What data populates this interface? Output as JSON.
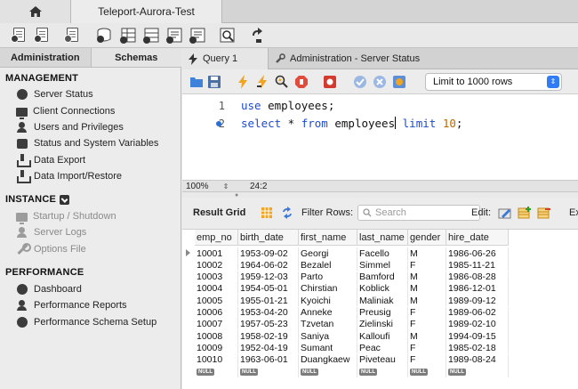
{
  "window": {
    "home_icon": "home-icon",
    "connection_tab": "Teleport-Aurora-Test"
  },
  "toolbar": {
    "icons": [
      "new-sql-tab-icon",
      "open-sql-file-icon",
      "inspector-icon",
      "create-schema-icon",
      "create-table-icon",
      "create-view-icon",
      "create-procedure-icon",
      "create-function-icon",
      "search-table-data-icon",
      "reconnect-icon"
    ]
  },
  "sidebar": {
    "tabs": [
      {
        "label": "Administration",
        "active": true
      },
      {
        "label": "Schemas",
        "active": false
      }
    ],
    "sections": [
      {
        "title": "MANAGEMENT",
        "items": [
          {
            "label": "Server Status",
            "icon": "server-status-icon",
            "enabled": true
          },
          {
            "label": "Client Connections",
            "icon": "client-connections-icon",
            "enabled": true
          },
          {
            "label": "Users and Privileges",
            "icon": "users-icon",
            "enabled": true
          },
          {
            "label": "Status and System Variables",
            "icon": "variables-icon",
            "enabled": true
          },
          {
            "label": "Data Export",
            "icon": "data-export-icon",
            "enabled": true
          },
          {
            "label": "Data Import/Restore",
            "icon": "data-import-icon",
            "enabled": true
          }
        ]
      },
      {
        "title": "INSTANCE",
        "items": [
          {
            "label": "Startup / Shutdown",
            "icon": "startup-icon",
            "enabled": false
          },
          {
            "label": "Server Logs",
            "icon": "server-logs-icon",
            "enabled": false
          },
          {
            "label": "Options File",
            "icon": "wrench-icon",
            "enabled": false
          }
        ]
      },
      {
        "title": "PERFORMANCE",
        "items": [
          {
            "label": "Dashboard",
            "icon": "dashboard-icon",
            "enabled": true
          },
          {
            "label": "Performance Reports",
            "icon": "performance-reports-icon",
            "enabled": true
          },
          {
            "label": "Performance Schema Setup",
            "icon": "performance-setup-icon",
            "enabled": true
          }
        ]
      }
    ]
  },
  "query_tabs": [
    {
      "label": "Query 1",
      "icon": "lightning-icon",
      "active": true
    },
    {
      "label": "Administration - Server Status",
      "icon": "wrench-icon",
      "active": false
    }
  ],
  "editor_toolbar": {
    "limit_label": "Limit to 1000 rows"
  },
  "editor": {
    "lines": [
      {
        "num": "1",
        "tokens": [
          {
            "t": "use",
            "k": "kw"
          },
          {
            "t": " employees;",
            "k": ""
          }
        ]
      },
      {
        "num": "2",
        "tokens": [
          {
            "t": "select",
            "k": "kw"
          },
          {
            "t": " * ",
            "k": ""
          },
          {
            "t": "from",
            "k": "kw"
          },
          {
            "t": " employees",
            "k": ""
          },
          {
            "t": "|",
            "k": "caret"
          },
          {
            "t": " ",
            "k": ""
          },
          {
            "t": "limit",
            "k": "kw"
          },
          {
            "t": " ",
            "k": ""
          },
          {
            "t": "10",
            "k": "num"
          },
          {
            "t": ";",
            "k": ""
          }
        ]
      }
    ],
    "zoom": "100%",
    "cursor_pos": "24:2"
  },
  "result_toolbar": {
    "title": "Result Grid",
    "filter_label": "Filter Rows:",
    "filter_placeholder": "Search",
    "edit_label": "Edit:",
    "export_label": "Ex"
  },
  "grid": {
    "columns": [
      "emp_no",
      "birth_date",
      "first_name",
      "last_name",
      "gender",
      "hire_date"
    ],
    "rows": [
      [
        "10001",
        "1953-09-02",
        "Georgi",
        "Facello",
        "M",
        "1986-06-26"
      ],
      [
        "10002",
        "1964-06-02",
        "Bezalel",
        "Simmel",
        "F",
        "1985-11-21"
      ],
      [
        "10003",
        "1959-12-03",
        "Parto",
        "Bamford",
        "M",
        "1986-08-28"
      ],
      [
        "10004",
        "1954-05-01",
        "Chirstian",
        "Koblick",
        "M",
        "1986-12-01"
      ],
      [
        "10005",
        "1955-01-21",
        "Kyoichi",
        "Maliniak",
        "M",
        "1989-09-12"
      ],
      [
        "10006",
        "1953-04-20",
        "Anneke",
        "Preusig",
        "F",
        "1989-06-02"
      ],
      [
        "10007",
        "1957-05-23",
        "Tzvetan",
        "Zielinski",
        "F",
        "1989-02-10"
      ],
      [
        "10008",
        "1958-02-19",
        "Saniya",
        "Kalloufi",
        "M",
        "1994-09-15"
      ],
      [
        "10009",
        "1952-04-19",
        "Sumant",
        "Peac",
        "F",
        "1985-02-18"
      ],
      [
        "10010",
        "1963-06-01",
        "Duangkaew",
        "Piveteau",
        "F",
        "1989-08-24"
      ]
    ],
    "null_label": "NULL"
  }
}
